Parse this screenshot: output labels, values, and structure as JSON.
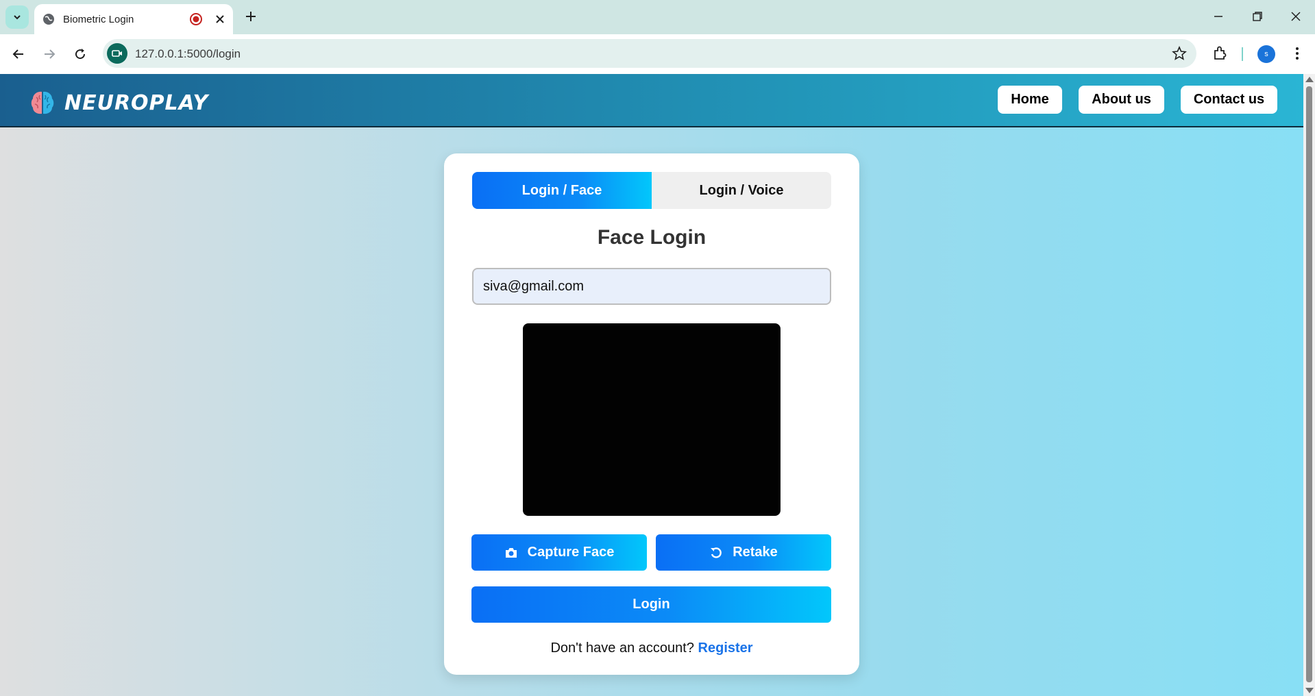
{
  "browser": {
    "tab_title": "Biometric Login",
    "url": "127.0.0.1:5000/login",
    "profile_initial": "s",
    "icons": [
      "tab-search-icon",
      "globe-icon",
      "recording-icon",
      "close-icon",
      "new-tab-icon",
      "minimize-icon",
      "restore-icon",
      "window-close-icon",
      "back-icon",
      "forward-icon",
      "reload-icon",
      "camera-site-icon",
      "bookmark-star-icon",
      "extensions-icon",
      "menu-icon"
    ]
  },
  "site": {
    "brand": "NEUROPLAY",
    "nav": [
      "Home",
      "About us",
      "Contact us"
    ]
  },
  "login": {
    "tab_face": "Login / Face",
    "tab_voice": "Login / Voice",
    "title": "Face Login",
    "email_value": "siva@gmail.com",
    "capture_label": "Capture Face",
    "retake_label": "Retake",
    "login_label": "Login",
    "no_account_text": "Don't have an account?",
    "register_label": "Register"
  },
  "colors": {
    "header_start": "#1a5f8f",
    "header_end": "#2ab5d4",
    "button_start": "#0a6ff5",
    "button_end": "#02c7fb",
    "link": "#1a73e8"
  }
}
